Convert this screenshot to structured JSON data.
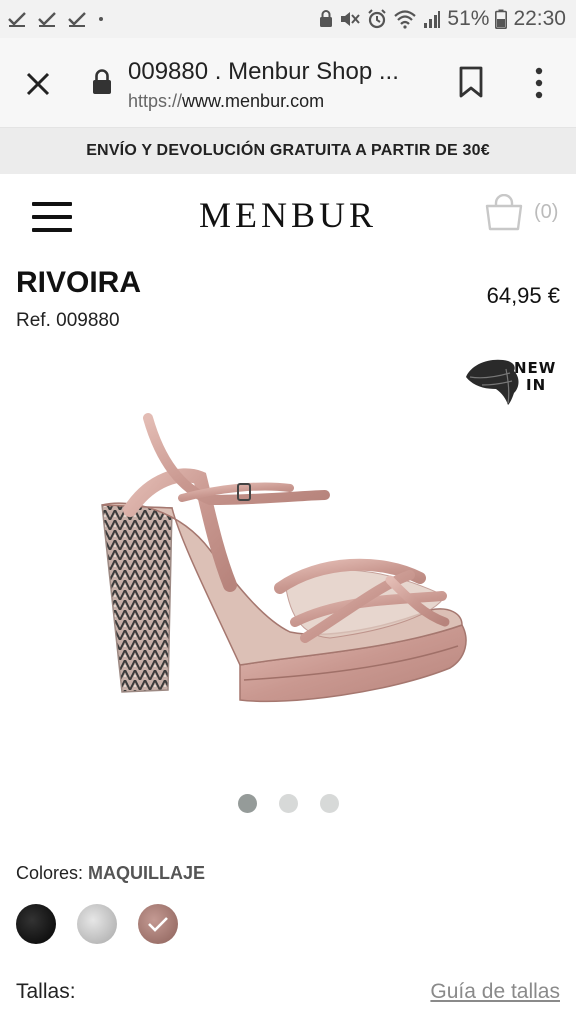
{
  "status_bar": {
    "battery": "51%",
    "time": "22:30"
  },
  "browser": {
    "title": "009880 . Menbur Shop ...",
    "url_scheme": "https://",
    "url_host": "www.menbur.com"
  },
  "promo": {
    "text": "ENVÍO Y DEVOLUCIÓN GRATUITA A PARTIR DE 30€"
  },
  "header": {
    "logo": "MENBUR",
    "cart_count": "(0)"
  },
  "product": {
    "name": "RIVOIRA",
    "ref": "Ref. 009880",
    "price": "64,95 €",
    "badge_line1": "NEW",
    "badge_line2": "IN",
    "image_alt": "shoe-image",
    "carousel_active_index": 0,
    "carousel_total": 3
  },
  "colors": {
    "label": "Colores:",
    "selected": "MAQUILLAJE",
    "swatches": [
      {
        "name": "black",
        "color": "#1a1a1a"
      },
      {
        "name": "silver",
        "color": "#c4c4c4"
      },
      {
        "name": "maquillaje",
        "color": "#a97d76",
        "selected": true
      }
    ]
  },
  "sizes": {
    "label": "Tallas:",
    "guide_link": "Guía de tallas"
  }
}
